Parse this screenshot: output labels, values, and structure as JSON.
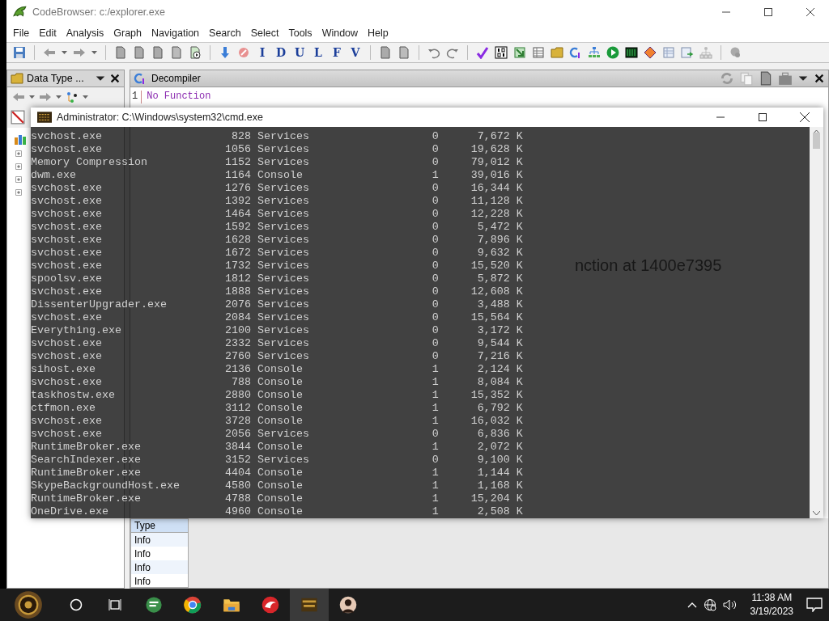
{
  "window": {
    "title": "CodeBrowser: c:/explorer.exe"
  },
  "menu": [
    "File",
    "Edit",
    "Analysis",
    "Graph",
    "Navigation",
    "Search",
    "Select",
    "Tools",
    "Window",
    "Help"
  ],
  "toolbar": {
    "letters": [
      "I",
      "D",
      "U",
      "L",
      "F",
      "V"
    ]
  },
  "data_type_panel": {
    "title": "Data Type ..."
  },
  "decompiler": {
    "title": "Decompiler",
    "line_number": "1",
    "code": "No Function"
  },
  "background_caption": "nction at 1400e7395",
  "log_table": {
    "columns": [
      "Type"
    ],
    "rows": [
      "Info",
      "Info",
      "Info",
      "Info"
    ]
  },
  "console": {
    "title": "Administrator: C:\\Windows\\system32\\cmd.exe",
    "rows": [
      {
        "image": "svchost.exe",
        "pid": "828",
        "session": "Services",
        "session_number": "0",
        "memory": "7,672 K"
      },
      {
        "image": "svchost.exe",
        "pid": "1056",
        "session": "Services",
        "session_number": "0",
        "memory": "19,628 K"
      },
      {
        "image": "Memory Compression",
        "pid": "1152",
        "session": "Services",
        "session_number": "0",
        "memory": "79,012 K"
      },
      {
        "image": "dwm.exe",
        "pid": "1164",
        "session": "Console",
        "session_number": "1",
        "memory": "39,016 K"
      },
      {
        "image": "svchost.exe",
        "pid": "1276",
        "session": "Services",
        "session_number": "0",
        "memory": "16,344 K"
      },
      {
        "image": "svchost.exe",
        "pid": "1392",
        "session": "Services",
        "session_number": "0",
        "memory": "11,128 K"
      },
      {
        "image": "svchost.exe",
        "pid": "1464",
        "session": "Services",
        "session_number": "0",
        "memory": "12,228 K"
      },
      {
        "image": "svchost.exe",
        "pid": "1592",
        "session": "Services",
        "session_number": "0",
        "memory": "5,472 K"
      },
      {
        "image": "svchost.exe",
        "pid": "1628",
        "session": "Services",
        "session_number": "0",
        "memory": "7,896 K"
      },
      {
        "image": "svchost.exe",
        "pid": "1672",
        "session": "Services",
        "session_number": "0",
        "memory": "9,632 K"
      },
      {
        "image": "svchost.exe",
        "pid": "1732",
        "session": "Services",
        "session_number": "0",
        "memory": "15,520 K"
      },
      {
        "image": "spoolsv.exe",
        "pid": "1812",
        "session": "Services",
        "session_number": "0",
        "memory": "5,872 K"
      },
      {
        "image": "svchost.exe",
        "pid": "1888",
        "session": "Services",
        "session_number": "0",
        "memory": "12,608 K"
      },
      {
        "image": "DissenterUpgrader.exe",
        "pid": "2076",
        "session": "Services",
        "session_number": "0",
        "memory": "3,488 K"
      },
      {
        "image": "svchost.exe",
        "pid": "2084",
        "session": "Services",
        "session_number": "0",
        "memory": "15,564 K"
      },
      {
        "image": "Everything.exe",
        "pid": "2100",
        "session": "Services",
        "session_number": "0",
        "memory": "3,172 K"
      },
      {
        "image": "svchost.exe",
        "pid": "2332",
        "session": "Services",
        "session_number": "0",
        "memory": "9,544 K"
      },
      {
        "image": "svchost.exe",
        "pid": "2760",
        "session": "Services",
        "session_number": "0",
        "memory": "7,216 K"
      },
      {
        "image": "sihost.exe",
        "pid": "2136",
        "session": "Console",
        "session_number": "1",
        "memory": "2,124 K"
      },
      {
        "image": "svchost.exe",
        "pid": "788",
        "session": "Console",
        "session_number": "1",
        "memory": "8,084 K"
      },
      {
        "image": "taskhostw.exe",
        "pid": "2880",
        "session": "Console",
        "session_number": "1",
        "memory": "15,352 K"
      },
      {
        "image": "ctfmon.exe",
        "pid": "3112",
        "session": "Console",
        "session_number": "1",
        "memory": "6,792 K"
      },
      {
        "image": "svchost.exe",
        "pid": "3728",
        "session": "Console",
        "session_number": "1",
        "memory": "16,032 K"
      },
      {
        "image": "svchost.exe",
        "pid": "2056",
        "session": "Services",
        "session_number": "0",
        "memory": "6,836 K"
      },
      {
        "image": "RuntimeBroker.exe",
        "pid": "3844",
        "session": "Console",
        "session_number": "1",
        "memory": "2,072 K"
      },
      {
        "image": "SearchIndexer.exe",
        "pid": "3152",
        "session": "Services",
        "session_number": "0",
        "memory": "9,100 K"
      },
      {
        "image": "RuntimeBroker.exe",
        "pid": "4404",
        "session": "Console",
        "session_number": "1",
        "memory": "1,144 K"
      },
      {
        "image": "SkypeBackgroundHost.exe",
        "pid": "4580",
        "session": "Console",
        "session_number": "1",
        "memory": "1,168 K"
      },
      {
        "image": "RuntimeBroker.exe",
        "pid": "4788",
        "session": "Console",
        "session_number": "1",
        "memory": "15,204 K"
      },
      {
        "image": "OneDrive.exe",
        "pid": "4960",
        "session": "Console",
        "session_number": "1",
        "memory": "2,508 K"
      }
    ]
  },
  "taskbar": {
    "apps": [
      {
        "selected": false
      },
      {
        "selected": false
      },
      {
        "selected": false
      },
      {
        "selected": false
      },
      {
        "selected": true
      },
      {
        "selected": false
      }
    ]
  },
  "clock": {
    "time": "11:38 AM",
    "date": "3/19/2023"
  }
}
